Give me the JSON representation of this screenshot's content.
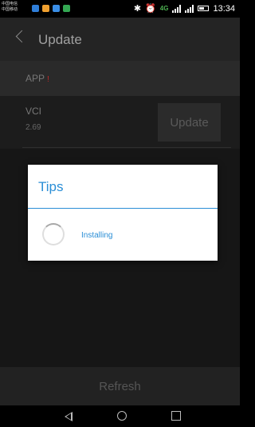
{
  "status_bar": {
    "carrier_lines": [
      "中国电信",
      "中国移动"
    ],
    "network": "4G",
    "time": "13:34"
  },
  "toolbar": {
    "title": "Update"
  },
  "app_row": {
    "label": "APP",
    "badge": "!"
  },
  "vci_row": {
    "name": "VCI",
    "version": "2.69",
    "button_label": "Update"
  },
  "dialog": {
    "title": "Tips",
    "message": "Installing"
  },
  "refresh_label": "Refresh",
  "colors": {
    "accent": "#2a8ed6",
    "badge": "#c62828",
    "background": "#161616"
  }
}
